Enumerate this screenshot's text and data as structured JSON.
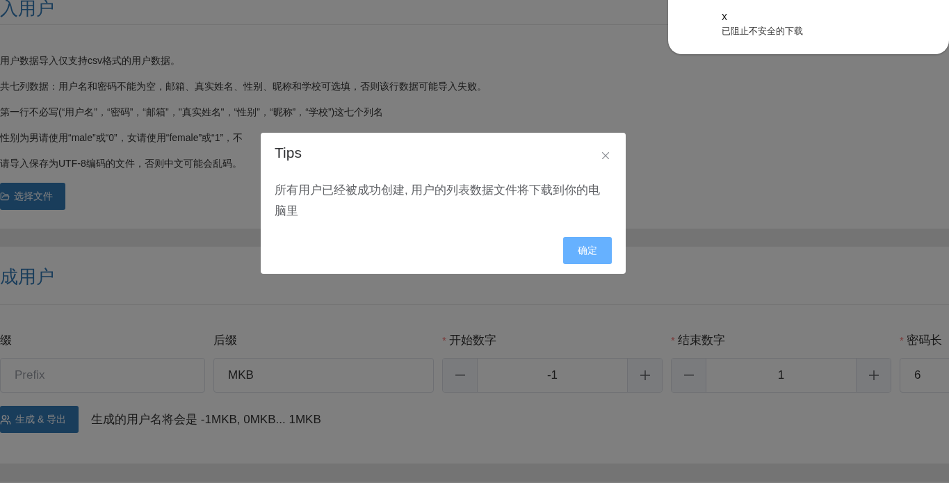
{
  "import_section": {
    "title": "入用户",
    "notes": [
      "用户数据导入仅支持csv格式的用户数据。",
      "共七列数据：用户名和密码不能为空，邮箱、真实姓名、性别、昵称和学校可选填，否则该行数据可能导入失败。",
      "第一行不必写(“用户名”，“密码”，“邮箱”，\"真实姓名\"，“性别”，“昵称”，“学校”)这七个列名",
      "性别为男请使用“male”或“0”，女请使用“female”或“1”，不",
      "请导入保存为UTF-8编码的文件，否则中文可能会乱码。"
    ],
    "button": "选择文件"
  },
  "generate_section": {
    "title": "成用户",
    "fields": [
      {
        "kind": "text",
        "label": "缀",
        "placeholder": "Prefix"
      },
      {
        "kind": "text",
        "label": "后缀",
        "value": "MKB"
      },
      {
        "kind": "number",
        "label": "开始数字",
        "required_mark": "*",
        "value": "-1"
      },
      {
        "kind": "number",
        "label": "结束数字",
        "required_mark": "*",
        "value": "1"
      },
      {
        "kind": "text",
        "label": "密码长",
        "required_mark": "*",
        "value": "6"
      }
    ],
    "button": "生成 & 导出",
    "hint": "生成的用户名将会是 -1MKB, 0MKB... 1MKB"
  },
  "dialog": {
    "title": "Tips",
    "message": "所有用户已经被成功创建, 用户的列表数据文件将下载到你的电脑里",
    "confirm": "确定"
  },
  "download_popup": {
    "filename_tail": "x",
    "status": "已阻止不安全的下载"
  }
}
